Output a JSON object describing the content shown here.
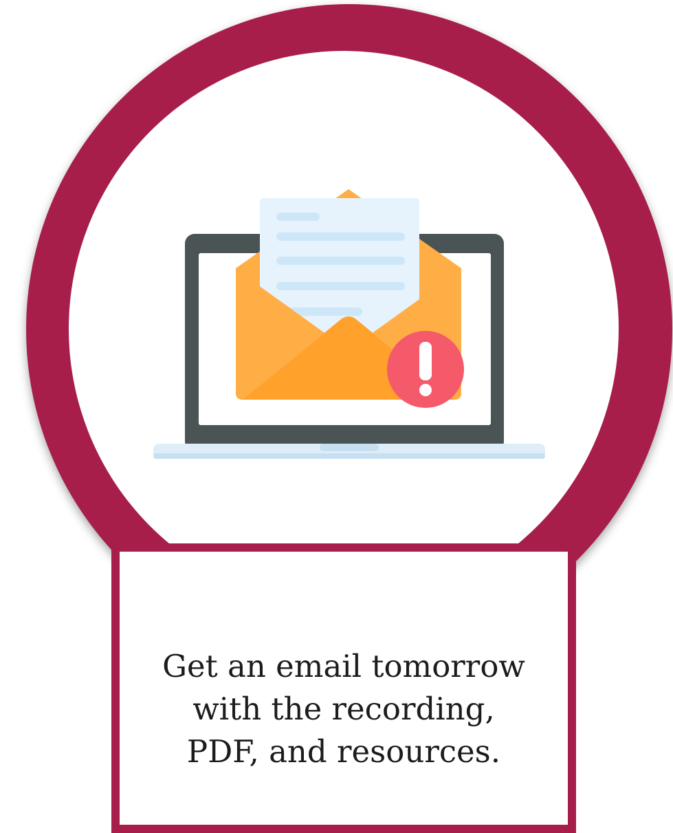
{
  "colors": {
    "accent": "#a71e4a",
    "laptop_frame": "#4b5454",
    "envelope": "#ffad45",
    "envelope_flap": "#ffa12b",
    "letter": "#e6f3fc",
    "alert": "#f45a6a"
  },
  "illustration": {
    "icon": "laptop-email-alert-icon"
  },
  "caption": {
    "lines": [
      "Get an email tomorrow",
      "with the recording,",
      "PDF, and resources."
    ]
  }
}
